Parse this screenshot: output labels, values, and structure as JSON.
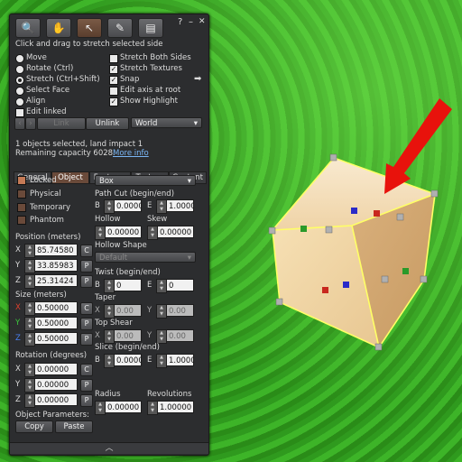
{
  "colors": {
    "accent": "#6a4a3a",
    "arrow": "#e8120c",
    "cube_outline": "#ffff66"
  },
  "toolbar": {
    "tools": [
      {
        "icon": "magnifier-icon",
        "glyph": "🔍"
      },
      {
        "icon": "grab-hand-icon",
        "glyph": "✋"
      },
      {
        "icon": "edit-pointer-icon",
        "glyph": "↖"
      },
      {
        "icon": "wand-icon",
        "glyph": "✎"
      },
      {
        "icon": "bulldozer-icon",
        "glyph": "▤"
      }
    ],
    "help": "?",
    "minimize": "–",
    "close": "✕"
  },
  "hint": "Click and drag to stretch selected side",
  "modes": [
    "Move",
    "Rotate (Ctrl)",
    "Stretch (Ctrl+Shift)",
    "Select Face",
    "Align"
  ],
  "edit_linked": "Edit linked",
  "options": [
    "Stretch Both Sides",
    "Stretch Textures",
    "Snap",
    "Edit axis at root",
    "Show Highlight"
  ],
  "link_row": {
    "link": "Link",
    "unlink": "Unlink",
    "world": "World"
  },
  "status": {
    "line1": "1 objects selected, land impact 1",
    "line2": "Remaining capacity 6028.",
    "more_info": "More info"
  },
  "tabs": [
    "General",
    "Object",
    "Features",
    "Texture",
    "Content"
  ],
  "object": {
    "locked": "Locked",
    "physical": "Physical",
    "temporary": "Temporary",
    "phantom": "Phantom",
    "position_label": "Position (meters)",
    "pos": {
      "x": "85.74580",
      "y": "33.85983",
      "z": "25.31424"
    },
    "size_label": "Size (meters)",
    "size": {
      "x": "0.50000",
      "y": "0.50000",
      "z": "0.50000"
    },
    "rotation_label": "Rotation (degrees)",
    "rot": {
      "x": "0.00000",
      "y": "0.00000",
      "z": "0.00000"
    },
    "params_label": "Object Parameters:",
    "copy": "Copy",
    "paste": "Paste",
    "c": "C",
    "p": "P"
  },
  "shape": {
    "type": "Box",
    "path_cut": "Path Cut (begin/end)",
    "b": "B",
    "e": "E",
    "path_b": "0.0000",
    "path_e": "1.0000",
    "hollow": "Hollow",
    "skew": "Skew",
    "hollow_val": "0.00000",
    "skew_val": "0.00000",
    "hollow_shape": "Hollow Shape",
    "hollow_shape_val": "Default",
    "twist": "Twist (begin/end)",
    "twist_b": "0",
    "twist_e": "0",
    "taper": "Taper",
    "taper_x": "0.00",
    "taper_y": "0.00",
    "top_shear": "Top Shear",
    "shear_x": "0.00",
    "shear_y": "0.00",
    "slice": "Slice (begin/end)",
    "slice_b": "0.0000",
    "slice_e": "1.0000",
    "radius": "Radius",
    "revolutions": "Revolutions",
    "radius_val": "0.00000",
    "rev_val": "1.00000",
    "x": "X",
    "y": "Y"
  },
  "axes": {
    "x": "X",
    "y": "Y",
    "z": "Z"
  },
  "footer_chevron": "︿"
}
